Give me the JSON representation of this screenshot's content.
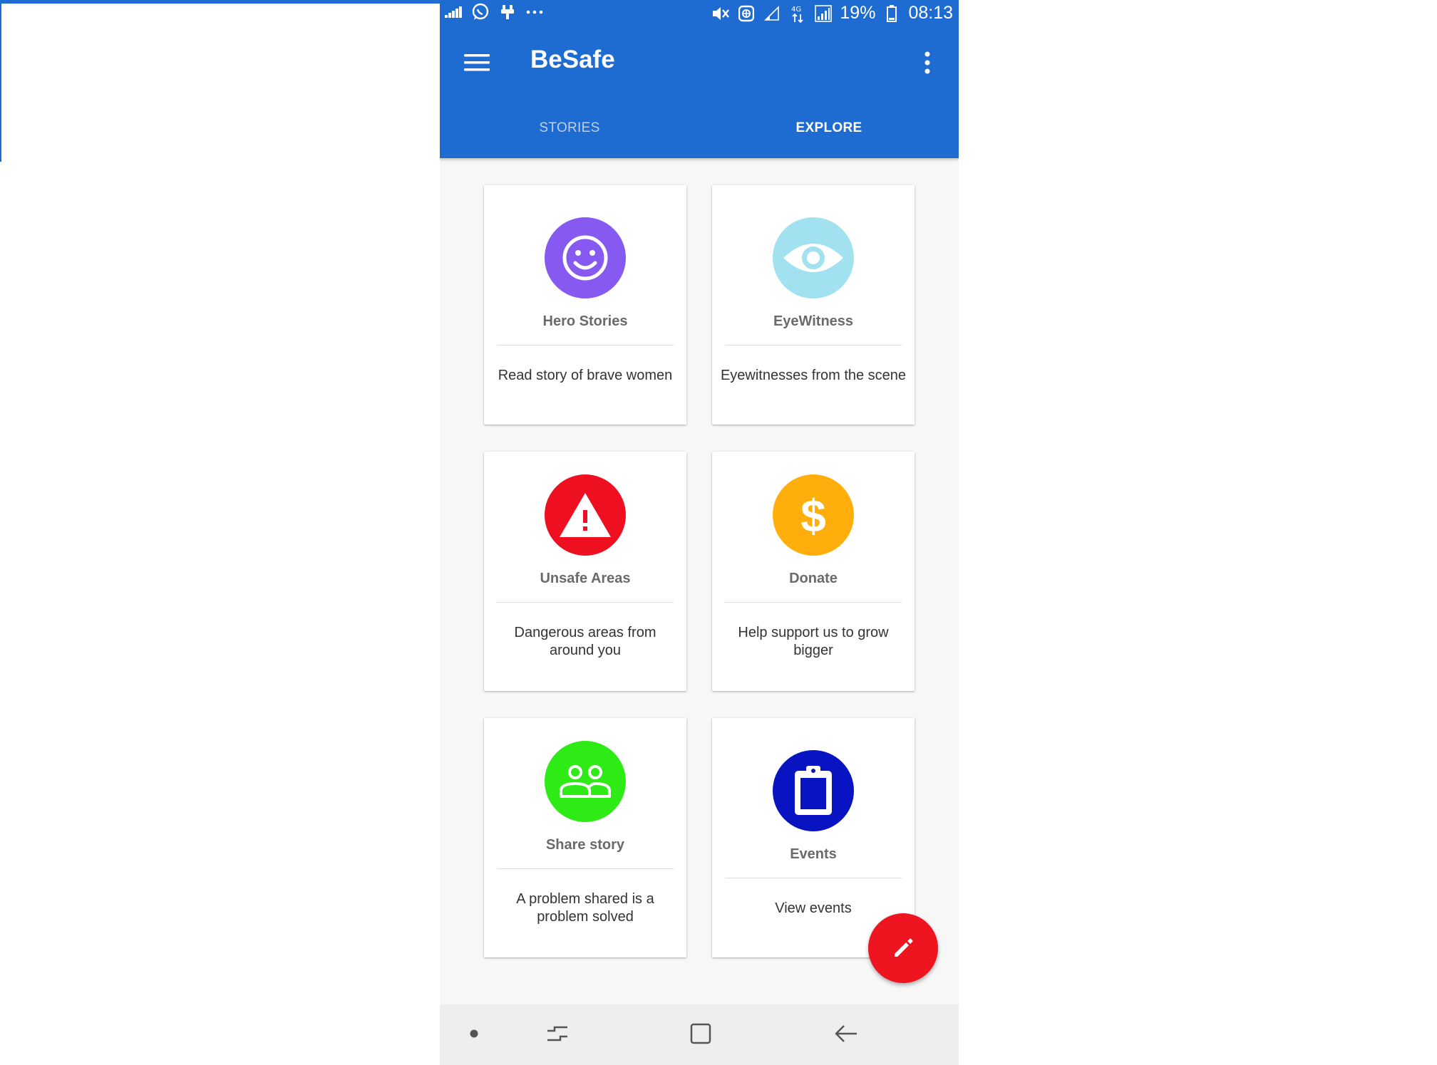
{
  "status_bar": {
    "battery": "19%",
    "time": "08:13"
  },
  "app_bar": {
    "title": "BeSafe"
  },
  "tabs": [
    {
      "label": "STORIES",
      "active": false
    },
    {
      "label": "EXPLORE",
      "active": true
    }
  ],
  "cards": [
    {
      "title": "Hero Stories",
      "description": "Read story of brave women",
      "icon": "smiley-icon",
      "color": "#8659F0"
    },
    {
      "title": "EyeWitness",
      "description": "Eyewitnesses from the scene",
      "icon": "eye-icon",
      "color": "#A1E1F0"
    },
    {
      "title": "Unsafe Areas",
      "description": "Dangerous areas from around you",
      "icon": "warning-icon",
      "color": "#EE1020"
    },
    {
      "title": "Donate",
      "description": "Help support us to grow bigger",
      "icon": "dollar-icon",
      "color": "#FFAE0C"
    },
    {
      "title": "Share story",
      "description": "A problem shared is a problem solved",
      "icon": "people-icon",
      "color": "#2EEB16"
    },
    {
      "title": "Events",
      "description": "View events",
      "icon": "clipboard-icon",
      "color": "#0814C2"
    }
  ],
  "fab": {
    "icon": "pencil-icon",
    "color": "#EE1520"
  },
  "colors": {
    "primary": "#1E6BD2",
    "background": "#F7F7F7"
  }
}
